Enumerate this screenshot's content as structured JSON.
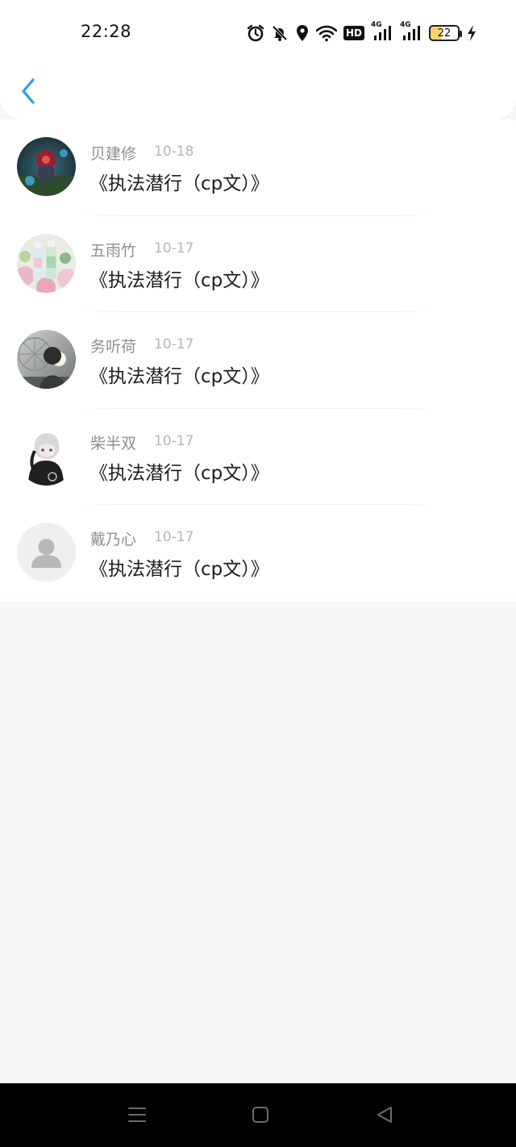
{
  "status_bar": {
    "time": "22:28",
    "hd_label": "HD",
    "net1": "4G",
    "net2": "4G",
    "battery": "22"
  },
  "colors": {
    "accent": "#2f9be6",
    "page_bg": "#f8f6f7",
    "name_text": "#8e8e8e",
    "date_text": "#b4b4b4",
    "title_text": "#1d1d1d"
  },
  "header": {
    "back_icon": "chevron-left-icon"
  },
  "items": [
    {
      "name": "贝建修",
      "date": "10-18",
      "title": "《执法潜行（cp文）》",
      "avatar": "game-character-avatar"
    },
    {
      "name": "五雨竹",
      "date": "10-17",
      "title": "《执法潜行（cp文）》",
      "avatar": "bottles-flowers-avatar"
    },
    {
      "name": "务听荷",
      "date": "10-17",
      "title": "《执法潜行（cp文）》",
      "avatar": "silhouette-ferris-wheel-avatar"
    },
    {
      "name": "柴半双",
      "date": "10-17",
      "title": "《执法潜行（cp文）》",
      "avatar": "anime-character-avatar"
    },
    {
      "name": "戴乃心",
      "date": "10-17",
      "title": "《执法潜行（cp文）》",
      "avatar": "default-user-avatar"
    }
  ],
  "nav": {
    "menu_icon": "menu-icon",
    "home_icon": "home-square-icon",
    "back_icon": "back-triangle-icon"
  }
}
